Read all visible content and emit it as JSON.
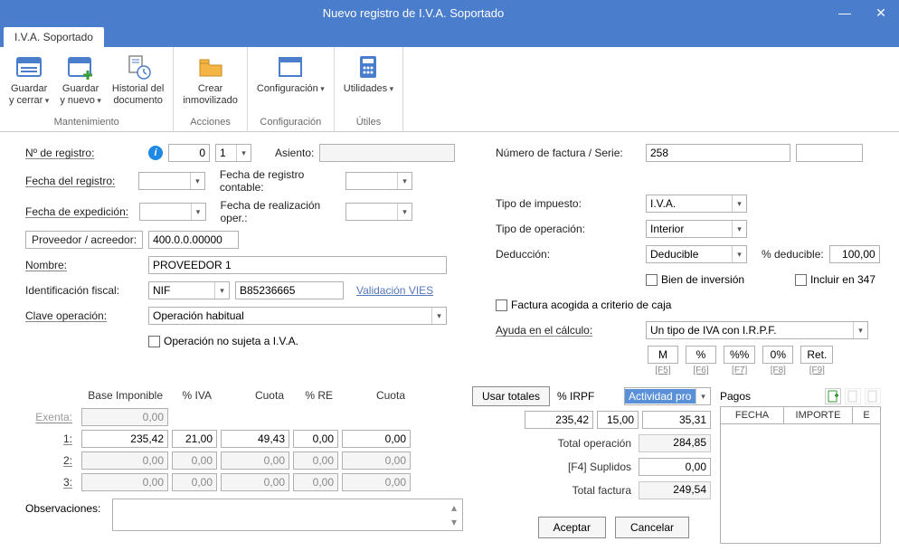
{
  "window": {
    "title": "Nuevo registro de I.V.A. Soportado"
  },
  "tab": {
    "label": "I.V.A. Soportado"
  },
  "ribbon": {
    "groups": [
      {
        "title": "Mantenimiento",
        "items": [
          {
            "label": "Guardar\ny cerrar"
          },
          {
            "label": "Guardar\ny nuevo"
          },
          {
            "label": "Historial del\ndocumento"
          }
        ]
      },
      {
        "title": "Acciones",
        "items": [
          {
            "label": "Crear\ninmovilizado"
          }
        ]
      },
      {
        "title": "Configuración",
        "items": [
          {
            "label": "Configuración"
          }
        ]
      },
      {
        "title": "Útiles",
        "items": [
          {
            "label": "Utilidades"
          }
        ]
      }
    ]
  },
  "left": {
    "n_registro_lbl": "Nº de registro:",
    "n_registro_a": "0",
    "n_registro_b": "1",
    "asiento_lbl": "Asiento:",
    "fecha_registro_lbl": "Fecha del registro:",
    "fecha_reg_cont_lbl": "Fecha de registro contable:",
    "fecha_exp_lbl": "Fecha de expedición:",
    "fecha_real_lbl": "Fecha de realización oper.:",
    "proveedor_lbl": "Proveedor / acreedor:",
    "proveedor_val": "400.0.0.00000",
    "nombre_lbl": "Nombre:",
    "nombre_val": "PROVEEDOR 1",
    "id_fiscal_lbl": "Identificación fiscal:",
    "id_fiscal_tipo": "NIF",
    "id_fiscal_num": "B85236665",
    "validacion_link": "Validación VIES",
    "clave_op_lbl": "Clave operación:",
    "clave_op_val": "Operación habitual",
    "op_no_sujeta": "Operación no sujeta a I.V.A."
  },
  "right": {
    "num_factura_lbl": "Número de factura / Serie:",
    "num_factura_val": "258",
    "tipo_impuesto_lbl": "Tipo de impuesto:",
    "tipo_impuesto_val": "I.V.A.",
    "tipo_oper_lbl": "Tipo de operación:",
    "tipo_oper_val": "Interior",
    "deduccion_lbl": "Deducción:",
    "deduccion_val": "Deducible",
    "pct_deducible_lbl": "% deducible:",
    "pct_deducible_val": "100,00",
    "bien_inv": "Bien de inversión",
    "incluir_347": "Incluir en 347",
    "factura_caja": "Factura acogida a criterio de caja",
    "ayuda_lbl": "Ayuda en el cálculo:",
    "ayuda_val": "Un tipo de IVA con I.R.P.F.",
    "btns": {
      "m": "M",
      "pct": "%",
      "dpct": "%%",
      "zero": "0%",
      "ret": "Ret."
    },
    "keys": {
      "m": "[F5]",
      "pct": "[F6]",
      "dpct": "[F7]",
      "zero": "[F8]",
      "ret": "[F9]"
    }
  },
  "lines": {
    "headers": {
      "base": "Base Imponible",
      "iva": "% IVA",
      "cuota": "Cuota",
      "re": "% RE",
      "cuota2": "Cuota"
    },
    "exenta_lbl": "Exenta:",
    "exenta_val": "0,00",
    "rows": [
      {
        "lbl": "1:",
        "base": "235,42",
        "iva": "21,00",
        "cuota": "49,43",
        "re": "0,00",
        "cuota2": "0,00"
      },
      {
        "lbl": "2:",
        "base": "0,00",
        "iva": "0,00",
        "cuota": "0,00",
        "re": "0,00",
        "cuota2": "0,00"
      },
      {
        "lbl": "3:",
        "base": "0,00",
        "iva": "0,00",
        "cuota": "0,00",
        "re": "0,00",
        "cuota2": "0,00"
      }
    ],
    "obs_lbl": "Observaciones:"
  },
  "mid": {
    "usar_totales": "Usar totales",
    "irpf_lbl": "% IRPF",
    "actividad_val": "Actividad pro",
    "irpf_base": "235,42",
    "irpf_pct": "15,00",
    "irpf_cuota": "35,31",
    "total_oper_lbl": "Total operación",
    "total_oper_val": "284,85",
    "suplidos_lbl": "[F4] Suplidos",
    "suplidos_val": "0,00",
    "total_factura_lbl": "Total factura",
    "total_factura_val": "249,54"
  },
  "pagos": {
    "title": "Pagos",
    "cols": {
      "fecha": "FECHA",
      "importe": "IMPORTE",
      "e": "E"
    }
  },
  "actions": {
    "ok": "Aceptar",
    "cancel": "Cancelar"
  }
}
